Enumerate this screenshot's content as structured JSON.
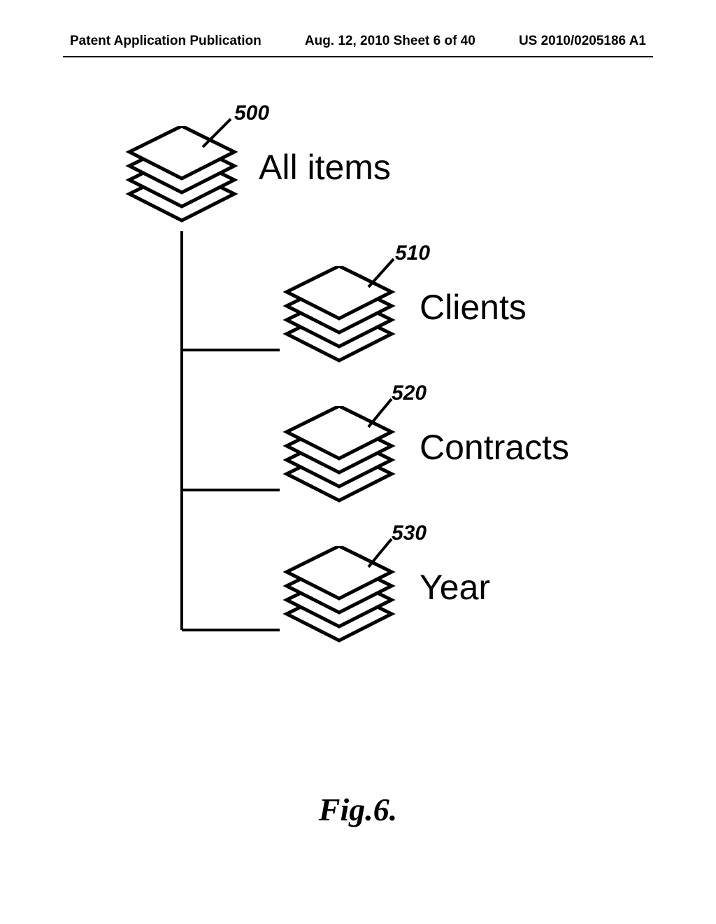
{
  "header": {
    "left": "Patent Application Publication",
    "center": "Aug. 12, 2010  Sheet 6 of 40",
    "right": "US 2010/0205186 A1"
  },
  "nodes": {
    "root": {
      "ref": "500",
      "label": "All items"
    },
    "n1": {
      "ref": "510",
      "label": "Clients"
    },
    "n2": {
      "ref": "520",
      "label": "Contracts"
    },
    "n3": {
      "ref": "530",
      "label": "Year"
    }
  },
  "figure": "Fig.6."
}
